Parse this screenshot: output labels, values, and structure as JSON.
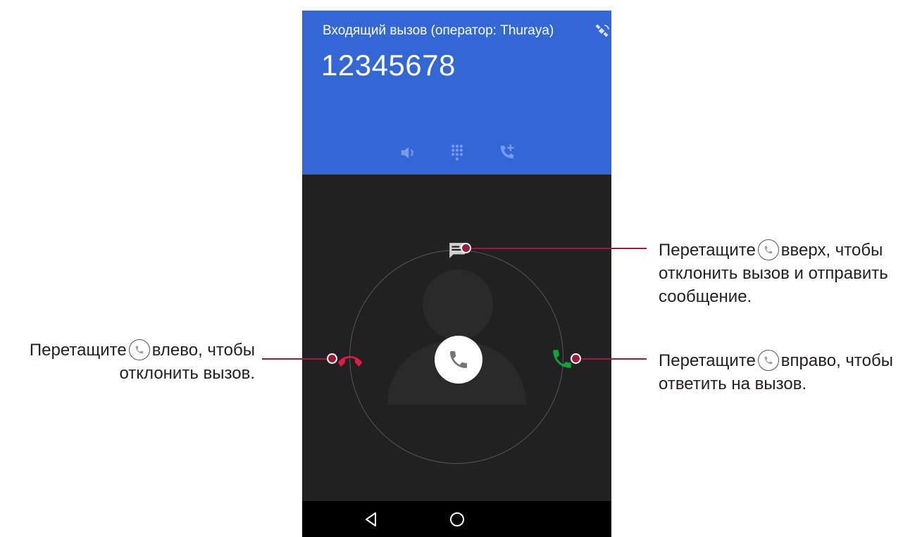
{
  "call": {
    "status": "Входящий вызов (оператор: Thuraya)",
    "number": "12345678",
    "satellite_icon": "satellite-icon",
    "controls": [
      "speaker-icon",
      "dialpad-icon",
      "add-call-icon"
    ]
  },
  "icons": {
    "message": "message-icon",
    "decline": "decline-call-icon",
    "accept": "accept-call-icon",
    "handle": "phone-icon"
  },
  "navbar": {
    "back": "back-icon",
    "home": "home-icon"
  },
  "annotations": {
    "left": {
      "prefix": "Перетащите",
      "suffix": "влево, чтобы",
      "line2": "отклонить вызов."
    },
    "top_right": {
      "prefix": "Перетащите",
      "suffix": "вверх, чтобы",
      "line2": "отклонить вызов и отправить",
      "line3": "сообщение."
    },
    "right": {
      "prefix": "Перетащите",
      "suffix": "вправо, чтобы",
      "line2": "ответить на вызов."
    }
  },
  "colors": {
    "header": "#3367d6",
    "screen_bg": "#212121",
    "decline": "#e8174a",
    "accept": "#0ca53c",
    "callout": "#9b1b3b"
  }
}
